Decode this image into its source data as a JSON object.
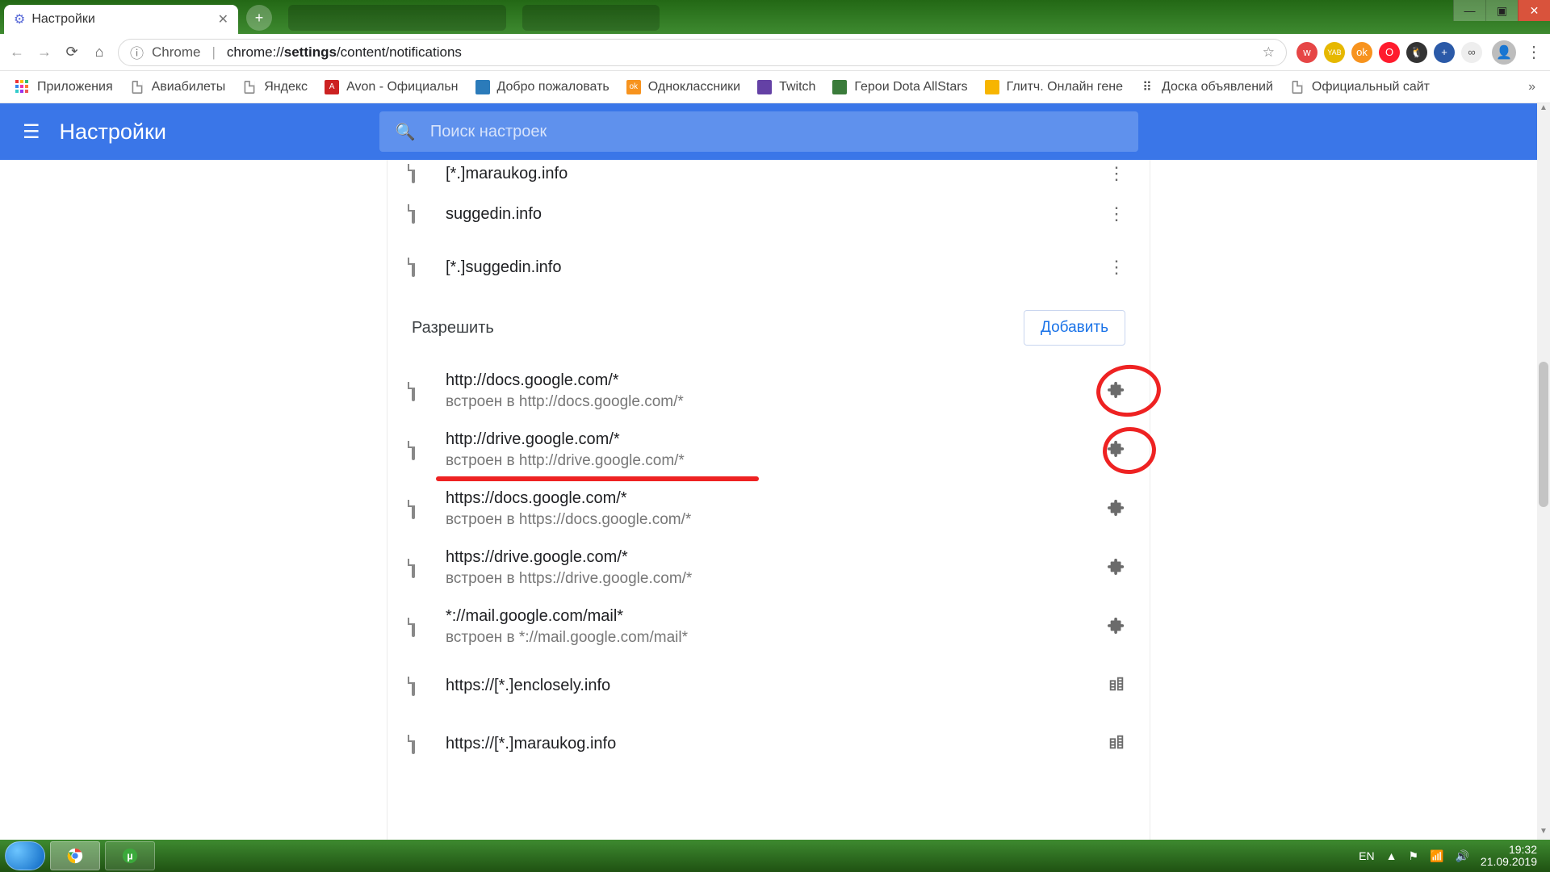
{
  "tab": {
    "title": "Настройки"
  },
  "toolbar": {
    "chrome_label": "Chrome",
    "url_display": "chrome://settings/content/notifications",
    "url_path_highlight": "settings"
  },
  "extensions": [
    {
      "name": "vk-icon",
      "bg": "#e64646",
      "glyph": "w"
    },
    {
      "name": "yab-icon",
      "bg": "#e6b800",
      "glyph": "YAB"
    },
    {
      "name": "ok-icon",
      "bg": "#f7931e",
      "glyph": "ok"
    },
    {
      "name": "opera-icon",
      "bg": "#ff1b2d",
      "glyph": "O"
    },
    {
      "name": "penguin-icon",
      "bg": "#333",
      "glyph": "🐧"
    },
    {
      "name": "save-icon",
      "bg": "#2b5aa8",
      "glyph": "+"
    },
    {
      "name": "loop-icon",
      "bg": "#eee",
      "glyph": "∞"
    }
  ],
  "bookmarks": [
    {
      "label": "Приложения",
      "name": "apps-bookmark",
      "icon": "apps"
    },
    {
      "label": "Авиабилеты",
      "name": "aviabilety-bookmark",
      "icon": "file"
    },
    {
      "label": "Яндекс",
      "name": "yandex-bookmark",
      "icon": "file"
    },
    {
      "label": "Avon - Официальн",
      "name": "avon-bookmark",
      "icon": "avon"
    },
    {
      "label": "Добро пожаловать",
      "name": "dobro-bookmark",
      "icon": "blue"
    },
    {
      "label": "Одноклассники",
      "name": "ok-bookmark",
      "icon": "ok"
    },
    {
      "label": "Twitch",
      "name": "twitch-bookmark",
      "icon": "twitch"
    },
    {
      "label": "Герои Dota AllStars",
      "name": "dota-bookmark",
      "icon": "green"
    },
    {
      "label": "Глитч. Онлайн гене",
      "name": "glitch-bookmark",
      "icon": "yellow"
    },
    {
      "label": "Доска объявлений",
      "name": "doska-bookmark",
      "icon": "dots"
    },
    {
      "label": "Официальный сайт",
      "name": "official-bookmark",
      "icon": "file"
    }
  ],
  "settings": {
    "title": "Настройки",
    "search_placeholder": "Поиск настроек",
    "block_items": [
      {
        "label": "[*.]maraukog.info"
      },
      {
        "label": "suggedin.info"
      },
      {
        "label": "[*.]suggedin.info"
      }
    ],
    "allow_header": "Разрешить",
    "add_button": "Добавить",
    "allow_items": [
      {
        "site": "http://docs.google.com/*",
        "embed": "встроен в http://docs.google.com/*",
        "rtype": "puzzle",
        "circled": true
      },
      {
        "site": "http://drive.google.com/*",
        "embed": "встроен в http://drive.google.com/*",
        "rtype": "puzzle",
        "circled": true,
        "underlined": true
      },
      {
        "site": "https://docs.google.com/*",
        "embed": "встроен в https://docs.google.com/*",
        "rtype": "puzzle"
      },
      {
        "site": "https://drive.google.com/*",
        "embed": "встроен в https://drive.google.com/*",
        "rtype": "puzzle"
      },
      {
        "site": "*://mail.google.com/mail*",
        "embed": "встроен в *://mail.google.com/mail*",
        "rtype": "puzzle"
      },
      {
        "site": "https://[*.]enclosely.info",
        "embed": "",
        "rtype": "building"
      },
      {
        "site": "https://[*.]maraukog.info",
        "embed": "",
        "rtype": "building"
      }
    ]
  },
  "tray": {
    "lang": "EN",
    "time": "19:32",
    "date": "21.09.2019"
  }
}
